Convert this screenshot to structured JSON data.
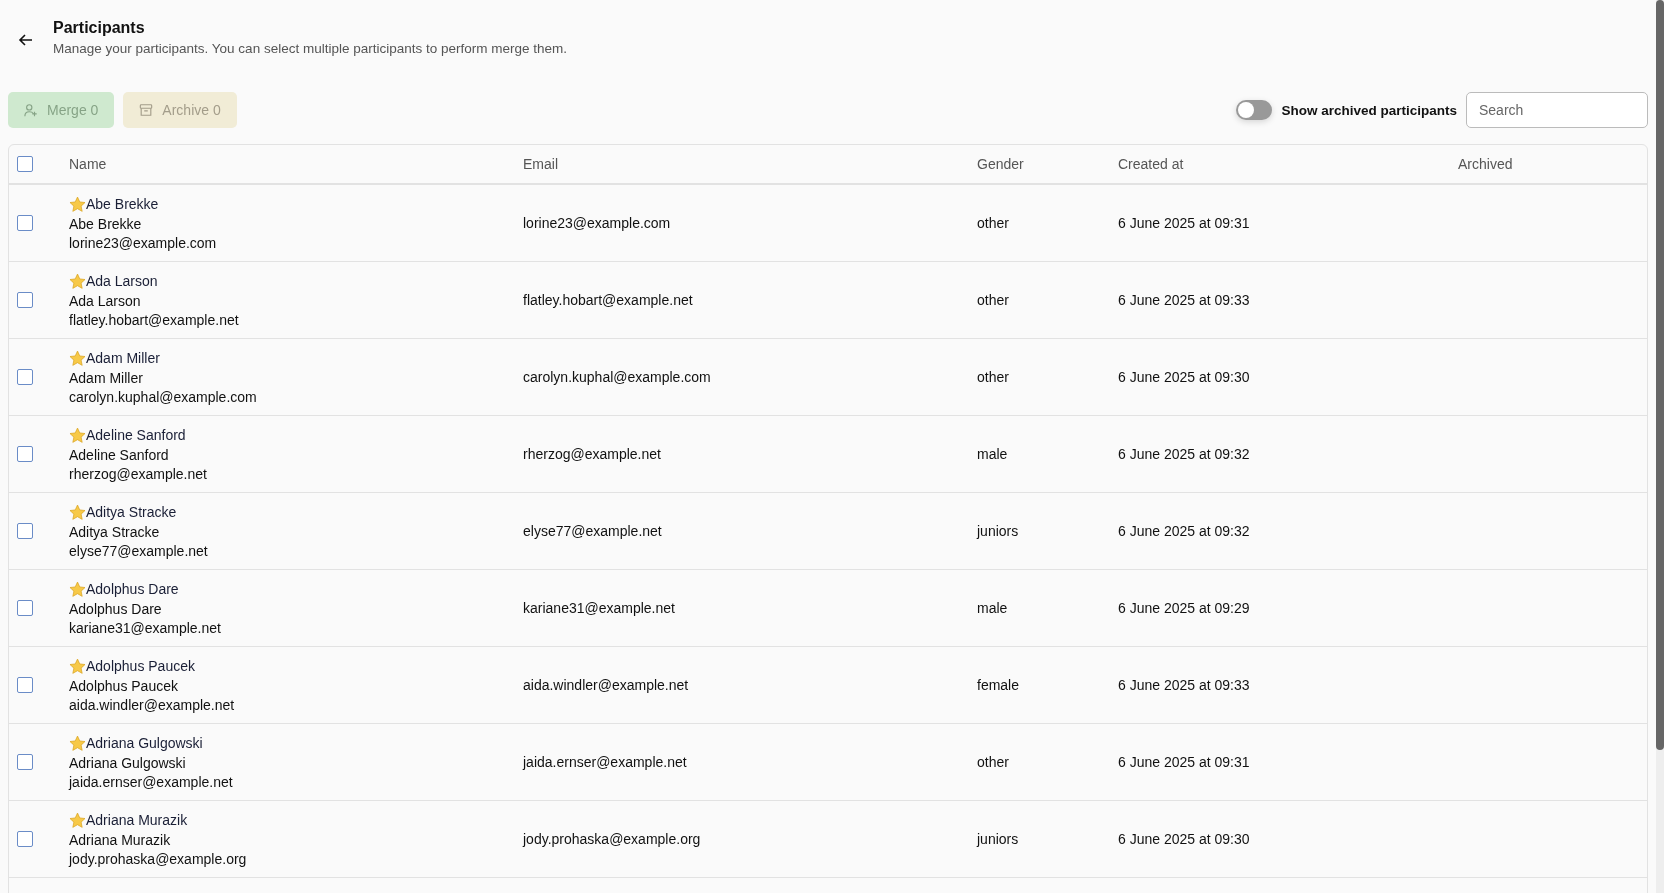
{
  "header": {
    "title": "Participants",
    "subtitle": "Manage your participants. You can select multiple participants to perform merge them."
  },
  "toolbar": {
    "merge": {
      "label": "Merge 0",
      "disabled": true
    },
    "archive": {
      "label": "Archive 0",
      "disabled": true
    },
    "show_archived": {
      "label": "Show archived participants",
      "on": false
    },
    "search": {
      "placeholder": "Search"
    }
  },
  "table": {
    "select_all": {
      "checked": false
    },
    "columns": [
      "Name",
      "Email",
      "Gender",
      "Created at",
      "Archived"
    ],
    "rows": [
      {
        "checked": false,
        "title": "Abe Brekke",
        "name": "Abe Brekke",
        "name_email": "lorine23@example.com",
        "email": "lorine23@example.com",
        "gender": "other",
        "created": "6 June 2025 at 09:31"
      },
      {
        "checked": false,
        "title": "Ada Larson",
        "name": "Ada Larson",
        "name_email": "flatley.hobart@example.net",
        "email": "flatley.hobart@example.net",
        "gender": "other",
        "created": "6 June 2025 at 09:33"
      },
      {
        "checked": false,
        "title": "Adam Miller",
        "name": "Adam Miller",
        "name_email": "carolyn.kuphal@example.com",
        "email": "carolyn.kuphal@example.com",
        "gender": "other",
        "created": "6 June 2025 at 09:30"
      },
      {
        "checked": false,
        "title": "Adeline Sanford",
        "name": "Adeline Sanford",
        "name_email": "rherzog@example.net",
        "email": "rherzog@example.net",
        "gender": "male",
        "created": "6 June 2025 at 09:32"
      },
      {
        "checked": false,
        "title": "Aditya Stracke",
        "name": "Aditya Stracke",
        "name_email": "elyse77@example.net",
        "email": "elyse77@example.net",
        "gender": "juniors",
        "created": "6 June 2025 at 09:32"
      },
      {
        "checked": false,
        "title": "Adolphus Dare",
        "name": "Adolphus Dare",
        "name_email": "kariane31@example.net",
        "email": "kariane31@example.net",
        "gender": "male",
        "created": "6 June 2025 at 09:29"
      },
      {
        "checked": false,
        "title": "Adolphus Paucek",
        "name": "Adolphus Paucek",
        "name_email": "aida.windler@example.net",
        "email": "aida.windler@example.net",
        "gender": "female",
        "created": "6 June 2025 at 09:33"
      },
      {
        "checked": false,
        "title": "Adriana Gulgowski",
        "name": "Adriana Gulgowski",
        "name_email": "jaida.ernser@example.net",
        "email": "jaida.ernser@example.net",
        "gender": "other",
        "created": "6 June 2025 at 09:31"
      },
      {
        "checked": false,
        "title": "Adriana Murazik",
        "name": "Adriana Murazik",
        "name_email": "jody.prohaska@example.org",
        "email": "jody.prohaska@example.org",
        "gender": "juniors",
        "created": "6 June 2025 at 09:30"
      }
    ]
  }
}
